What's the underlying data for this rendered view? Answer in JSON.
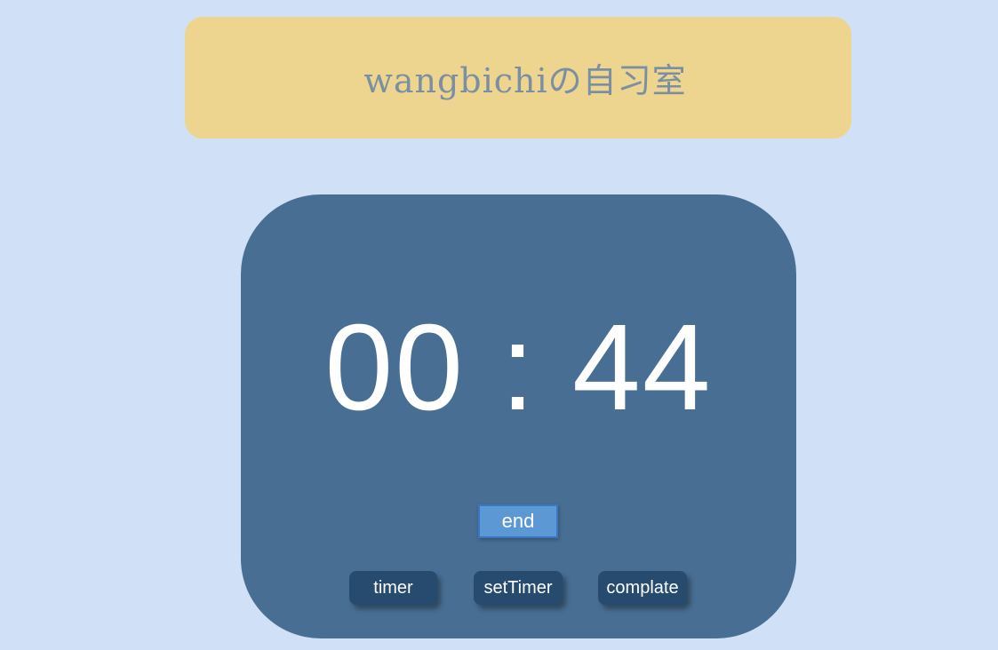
{
  "header": {
    "title": "wangbichiの自习室"
  },
  "timer": {
    "display": "00 : 44",
    "end_label": "end"
  },
  "modes": {
    "timer_label": "timer",
    "set_timer_label": "setTimer",
    "complate_label": "complate"
  },
  "colors": {
    "background": "#d0e0f6",
    "banner": "#edd48f",
    "banner_text": "#7b8fa3",
    "card": "#486e93",
    "end_button": "#5b98d4",
    "mode_button": "#264b6e"
  }
}
